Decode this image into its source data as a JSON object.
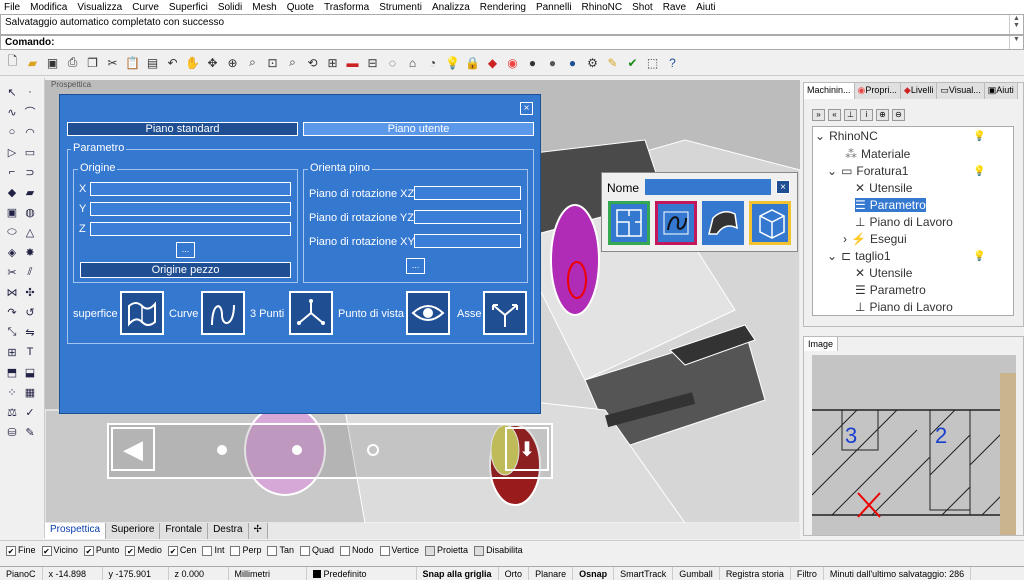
{
  "menu": [
    "File",
    "Modifica",
    "Visualizza",
    "Curve",
    "Superfici",
    "Solidi",
    "Mesh",
    "Quote",
    "Trasforma",
    "Strumenti",
    "Analizza",
    "Rendering",
    "Pannelli",
    "RhinoNC",
    "Shot",
    "Rave",
    "Aiuti"
  ],
  "history_text": "Salvataggio automatico completato con successo",
  "command_label": "Comando:",
  "viewport_title": "Prospettica",
  "dialog": {
    "close": "×",
    "tab_standard": "Piano standard",
    "tab_user": "Piano utente",
    "parametro_legend": "Parametro",
    "origine_legend": "Origine",
    "x": "X",
    "y": "Y",
    "z": "Z",
    "dots": "...",
    "origine_pezzo": "Origine pezzo",
    "orienta_legend": "Orienta pino",
    "rot_xz": "Piano di rotazione XZ",
    "rot_yz": "Piano di rotazione YZ",
    "rot_xy": "Piano di rotazione XY",
    "superfice": "superfice",
    "curve": "Curve",
    "tre_punti": "3 Punti",
    "punto_vista": "Punto di vista",
    "asse": "Asse"
  },
  "nome_popup": {
    "label": "Nome",
    "close": "×"
  },
  "view_tabs": [
    "Prospettica",
    "Superiore",
    "Frontale",
    "Destra"
  ],
  "osnap": [
    {
      "label": "Fine",
      "checked": true
    },
    {
      "label": "Vicino",
      "checked": true
    },
    {
      "label": "Punto",
      "checked": true
    },
    {
      "label": "Medio",
      "checked": true
    },
    {
      "label": "Cen",
      "checked": true
    },
    {
      "label": "Int",
      "checked": false
    },
    {
      "label": "Perp",
      "checked": false
    },
    {
      "label": "Tan",
      "checked": false
    },
    {
      "label": "Quad",
      "checked": false
    },
    {
      "label": "Nodo",
      "checked": false
    },
    {
      "label": "Vertice",
      "checked": false
    },
    {
      "label": "Proietta",
      "checked": false
    },
    {
      "label": "Disabilita",
      "checked": false
    }
  ],
  "status": {
    "plane": "PianoC",
    "x": "x -14.898",
    "y": "y -175.901",
    "z": "z 0.000",
    "units": "Millimetri",
    "layer": "Predefinito",
    "snap": "Snap alla griglia",
    "orto": "Orto",
    "planare": "Planare",
    "osnap": "Osnap",
    "smarttrack": "SmartTrack",
    "gumball": "Gumball",
    "registra": "Registra storia",
    "filtro": "Filtro",
    "salvataggio": "Minuti dall'ultimo salvataggio: 286"
  },
  "right_tabs": [
    "Machinin...",
    "Propri...",
    "Livelli",
    "Visual...",
    "Aiuti"
  ],
  "tree": {
    "root": "RhinoNC",
    "materiale": "Materiale",
    "foratura": "Foratura1",
    "utensile": "Utensile",
    "parametro": "Parametro",
    "piano_lavoro": "Piano di Lavoro",
    "esegui": "Esegui",
    "taglio": "taglio1",
    "utensile2": "Utensile",
    "parametro2": "Parametro",
    "piano_lavoro2": "Piano di Lavoro"
  },
  "image_panel": {
    "title": "Image",
    "n3": "3",
    "n2": "2"
  },
  "colors": {
    "accent": "#3578d0",
    "dark": "#1f4f92",
    "snap_green": "#34a853"
  }
}
